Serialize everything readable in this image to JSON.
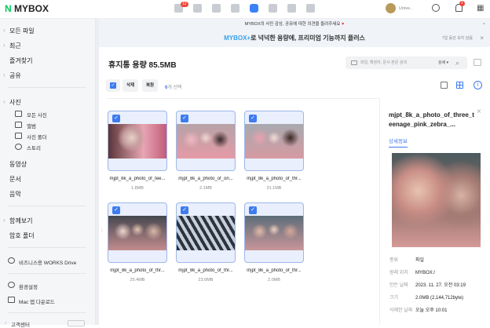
{
  "header": {
    "logo_mark": "N",
    "logo_text": "MYBOX",
    "mail_badge": "12",
    "user_name": "Unive..",
    "notif_badge": "2"
  },
  "sidebar": {
    "items": [
      {
        "label": "모든 파일"
      },
      {
        "label": "최근"
      },
      {
        "label": "즐겨찾기"
      },
      {
        "label": "공유"
      },
      {
        "label": "사진"
      },
      {
        "label": "모든 사진"
      },
      {
        "label": "앨범"
      },
      {
        "label": "사진 폴더"
      },
      {
        "label": "스토리"
      },
      {
        "label": "동영상"
      },
      {
        "label": "문서"
      },
      {
        "label": "음악"
      },
      {
        "label": "함께보기"
      },
      {
        "label": "암호 폴더"
      },
      {
        "label": "비즈니스용 WORKS Drive"
      },
      {
        "label": "환경설정"
      },
      {
        "label": "Mac 앱 다운로드"
      },
      {
        "label": "고객센터"
      }
    ]
  },
  "notice": {
    "text": "MYBOX의 사진 감상, 공유에 대한 의견을 들려주세요",
    "close": "×"
  },
  "promo": {
    "brand": "MYBOX+",
    "text": "로 넉넉한 용량에, 프리미엄 기능까지 플러스",
    "hide": "7일 동안 보지 않음",
    "close": "×"
  },
  "main": {
    "title": "휴지통 용량 85.5MB",
    "search_placeholder": "파일, 확장자, 문서 본문 검색",
    "search_detail": "상세 ▾",
    "toolbar": {
      "delete": "삭제",
      "restore": "복원",
      "selected_count": "6",
      "selected_suffix": "개 선택"
    },
    "files": [
      {
        "name": "mjpt_8k_a_photo_of_tee...",
        "size": "1.8MB"
      },
      {
        "name": "mjpt_8k_a_photo_of_on...",
        "size": "2.1MB"
      },
      {
        "name": "mjpt_8k_a_photo_of_thr...",
        "size": "31.1MB"
      },
      {
        "name": "mjpt_8k_a_photo_of_thr...",
        "size": "25.4MB"
      },
      {
        "name": "mjpt_8k_a_photo_of_thr...",
        "size": "23.0MB"
      },
      {
        "name": "mjpt_8k_a_photo_of_thr...",
        "size": "2.0MB"
      }
    ]
  },
  "panel": {
    "title": "mjpt_8k_a_photo_of_three_teenage_pink_zebra_...",
    "tab": "상세정보",
    "details": [
      {
        "k": "종류",
        "v": "파일"
      },
      {
        "k": "원래 위치",
        "v": "MYBOX:/"
      },
      {
        "k": "만든 날짜",
        "v": "2023. 11. 27. 오전 03:19"
      },
      {
        "k": "크기",
        "v": "2.0MB (2,144,712byte)"
      },
      {
        "k": "삭제한 날짜",
        "v": "오늘 오후 10:01"
      }
    ]
  },
  "colors": {
    "accent": "#3e7bf0",
    "brand": "#03c75a"
  }
}
